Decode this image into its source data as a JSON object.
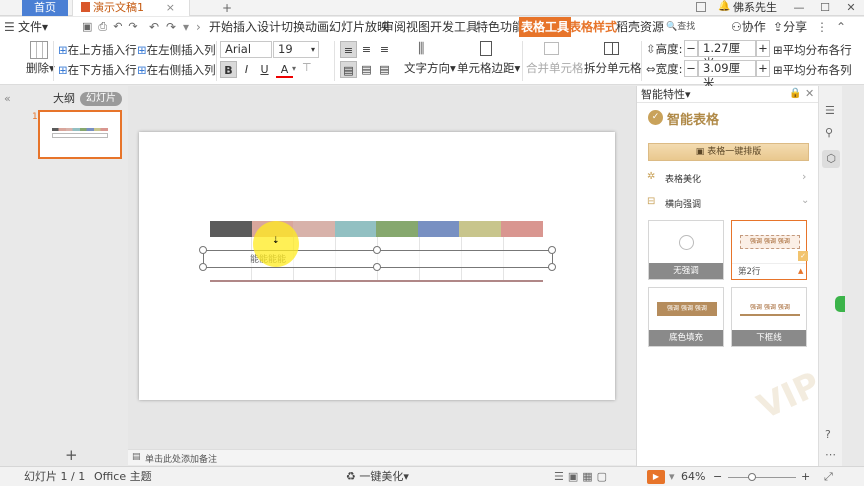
{
  "titlebar": {
    "home_tab": "首页",
    "doc_tab": "演示文稿1",
    "new_tab": "+",
    "user": "佛系先生",
    "close_tab": "×"
  },
  "menubar": {
    "file_menu": "文件",
    "items": [
      "开始",
      "插入",
      "设计",
      "切换",
      "动画",
      "幻灯片放映",
      "审阅",
      "视图",
      "开发工具",
      "特色功能"
    ],
    "active_tab": "表格工具",
    "style_tab": "表格样式",
    "template_tab": "稻壳资源",
    "search": "查找",
    "collab": "协作",
    "share": "分享"
  },
  "ribbon": {
    "delete": "删除",
    "insert_above": "在上方插入行",
    "insert_below": "在下方插入行",
    "insert_left": "在左侧插入列",
    "insert_right": "在右侧插入列",
    "font_name": "Arial (正文)",
    "font_size": "19",
    "bold": "B",
    "italic": "I",
    "underline": "U",
    "font_color": "A",
    "text_direction": "文字方向",
    "cell_margin": "单元格边距",
    "merge_cells": "合并单元格",
    "split_cells": "拆分单元格",
    "height_label": "高度:",
    "height_value": "1.27厘米",
    "width_label": "宽度:",
    "width_value": "3.09厘米",
    "distribute_rows": "平均分布各行",
    "distribute_cols": "平均分布各列"
  },
  "leftpanel": {
    "outline_tab": "大纲",
    "slides_tab": "幻灯片",
    "slide_number": "1",
    "add_slide": "+"
  },
  "slide": {
    "color_bar": [
      "#5b5b5b",
      "#d9a69c",
      "#d8b2aa",
      "#92c0c2",
      "#86a86e",
      "#7890c2",
      "#c8c58c",
      "#d99690"
    ],
    "cell_text": "能能能能"
  },
  "notes": {
    "placeholder": "单击此处添加备注"
  },
  "rpanel": {
    "header": "智能特性",
    "title": "智能表格",
    "one_click": "表格一键排版",
    "beautify": "表格美化",
    "emphasis": "横向强调",
    "cards": [
      {
        "caption": "无强调"
      },
      {
        "caption": "第2行"
      },
      {
        "caption": "底色填充"
      },
      {
        "caption": "下框线"
      }
    ],
    "cell_word": "强调",
    "watermark": "VIP",
    "accent": "#e7742a"
  },
  "statusbar": {
    "slide_info": "幻灯片 1 / 1",
    "theme": "Office 主题",
    "beautify": "一键美化",
    "zoom": "64%"
  }
}
